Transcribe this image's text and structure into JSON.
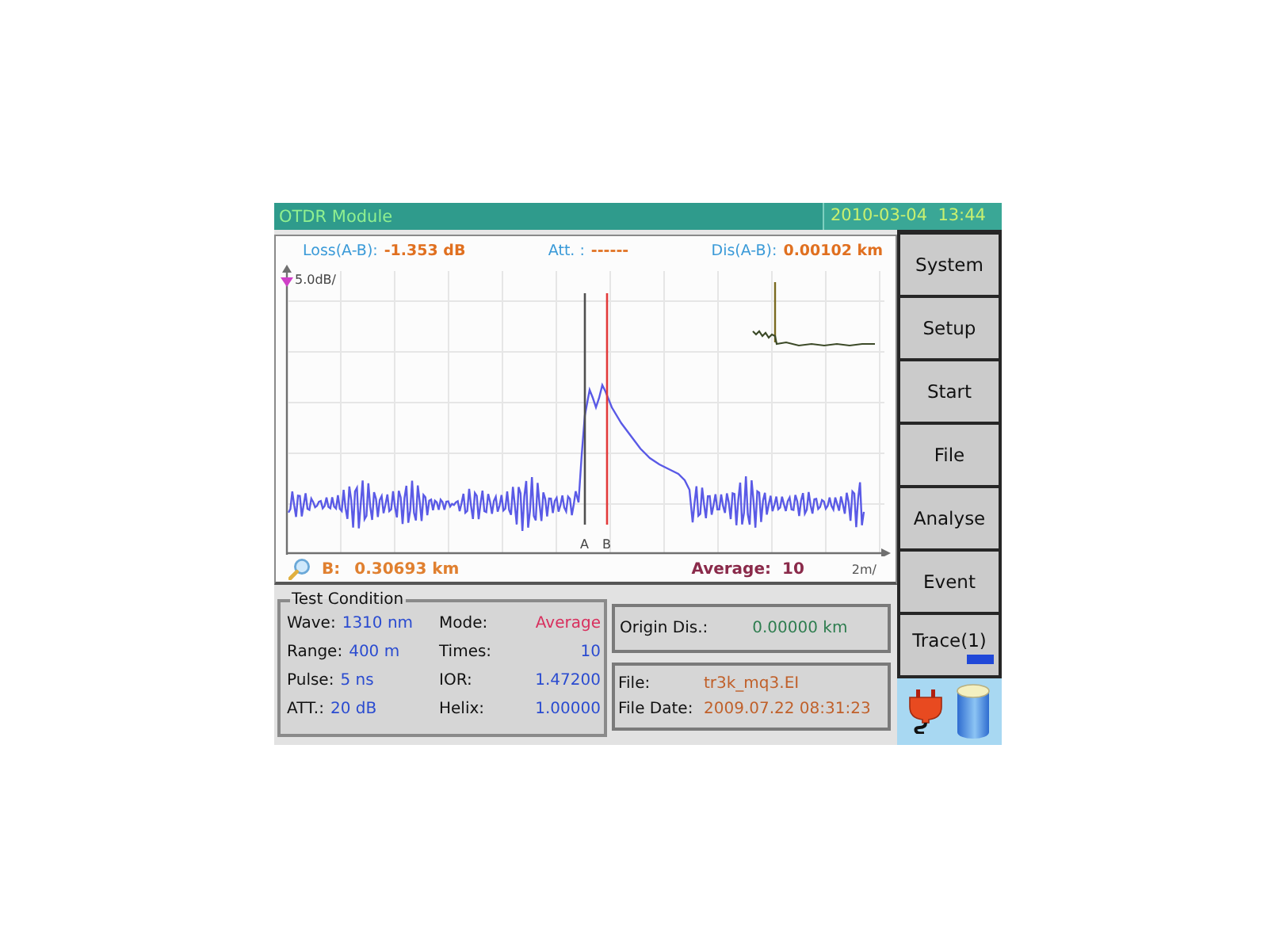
{
  "title_bar": {
    "title": "OTDR Module",
    "datetime": "2010-03-04  13:44"
  },
  "chart": {
    "readouts": [
      {
        "label": "Loss(A-B):",
        "value": "-1.353 dB"
      },
      {
        "label": "Att. :",
        "value": "------"
      },
      {
        "label": "Dis(A-B):",
        "value": "0.00102 km"
      }
    ],
    "y_scale": "5.0dB/",
    "x_scale": "2m/",
    "cursors": [
      {
        "label": "A",
        "selected": false
      },
      {
        "label": "B",
        "selected": true
      }
    ],
    "cursor_position": {
      "label": "B:",
      "value": "0.30693 km"
    },
    "average": {
      "label": "Average:",
      "value": "10"
    }
  },
  "test_condition": {
    "title": "Test Condition",
    "rows": [
      {
        "left": {
          "label": "Wave:",
          "value": "1310 nm",
          "color": "#2a4bd0"
        },
        "right": {
          "label": "Mode:",
          "value": "Average",
          "color": "#d8305e"
        }
      },
      {
        "left": {
          "label": "Range:",
          "value": "400 m",
          "color": "#2a4bd0"
        },
        "right": {
          "label": "Times:",
          "value": "10",
          "color": "#2a4bd0"
        }
      },
      {
        "left": {
          "label": "Pulse:",
          "value": "5 ns",
          "color": "#2a4bd0"
        },
        "right": {
          "label": "IOR:",
          "value": "1.47200",
          "color": "#2a4bd0"
        }
      },
      {
        "left": {
          "label": "ATT.:",
          "value": "20 dB",
          "color": "#2a4bd0"
        },
        "right": {
          "label": "Helix:",
          "value": "1.00000",
          "color": "#2a4bd0"
        }
      }
    ]
  },
  "origin": {
    "label": "Origin Dis.:",
    "value": "0.00000 km"
  },
  "file": [
    {
      "label": "File:",
      "value": "tr3k_mq3.EI"
    },
    {
      "label": "File Date:",
      "value": "2009.07.22 08:31:23"
    }
  ],
  "menu": [
    {
      "label": "System",
      "kind": "plain"
    },
    {
      "label": "Setup",
      "kind": "plain"
    },
    {
      "label": "Start",
      "kind": "plain"
    },
    {
      "label": "File",
      "kind": "plain"
    },
    {
      "label": "Analyse",
      "kind": "plain"
    },
    {
      "label": "Event",
      "kind": "plain"
    },
    {
      "label": "Trace(1)",
      "kind": "trace"
    }
  ]
}
